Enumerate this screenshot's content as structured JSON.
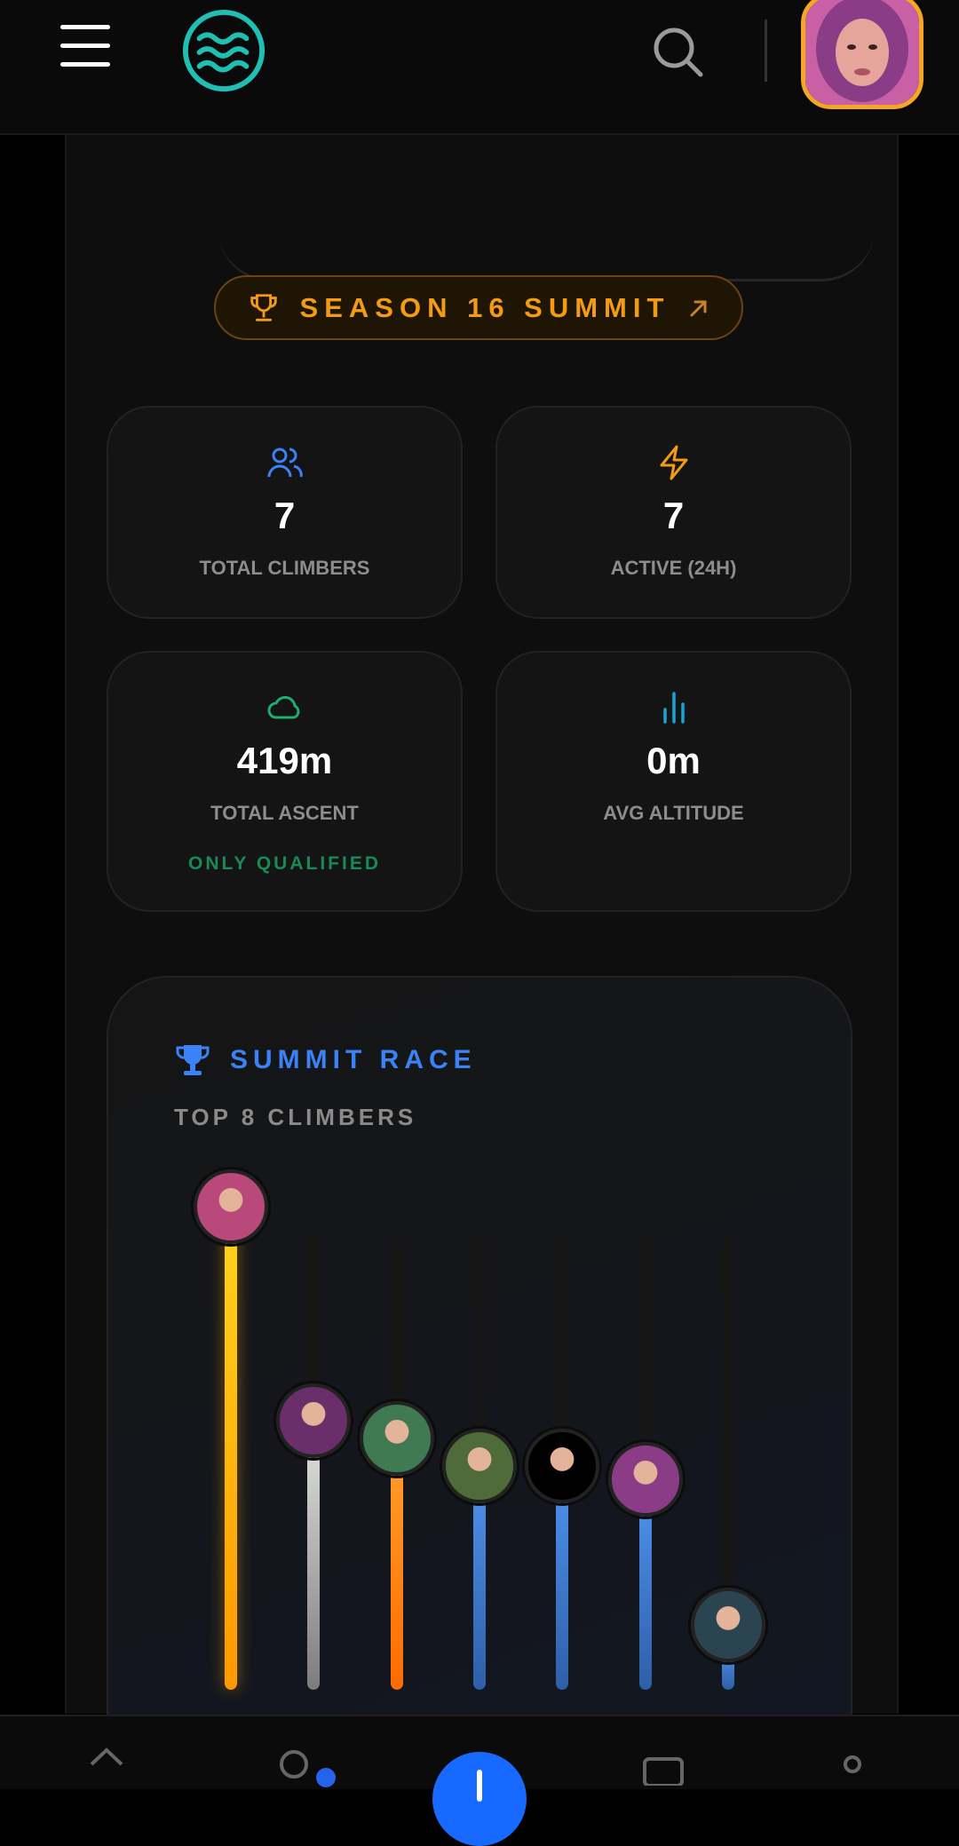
{
  "header": {
    "menu_icon": "hamburger-menu-icon",
    "logo_icon": "waves-logo-icon",
    "search_icon": "search-icon",
    "avatar_accent": "#f5a623"
  },
  "season": {
    "label": "SEASON 16 SUMMIT",
    "icon": "trophy-icon",
    "link_icon": "arrow-up-right-icon",
    "color": "#f39c12"
  },
  "stats": [
    {
      "icon": "users-icon",
      "color": "#3b82f6",
      "value": "7",
      "label": "TOTAL CLIMBERS"
    },
    {
      "icon": "lightning-icon",
      "color": "#f39c12",
      "value": "7",
      "label": "ACTIVE (24H)"
    },
    {
      "icon": "cloud-icon",
      "color": "#1fae72",
      "value": "419m",
      "label": "TOTAL ASCENT",
      "note": "ONLY QUALIFIED"
    },
    {
      "icon": "bar-chart-icon",
      "color": "#16a5d8",
      "value": "0m",
      "label": "AVG ALTITUDE"
    }
  ],
  "race": {
    "title": "SUMMIT RACE",
    "subtitle": "TOP 8 CLIMBERS",
    "climbers": [
      {
        "level": 1.0,
        "color": "gold"
      },
      {
        "level": 0.53,
        "color": "silver"
      },
      {
        "level": 0.49,
        "color": "bronze"
      },
      {
        "level": 0.43,
        "color": "blue"
      },
      {
        "level": 0.43,
        "color": "blue"
      },
      {
        "level": 0.4,
        "color": "blue"
      },
      {
        "level": 0.08,
        "color": "blue"
      }
    ]
  },
  "bottom_nav": {
    "items": [
      "home-icon",
      "people-icon",
      "add-icon",
      "inbox-icon",
      "profile-icon"
    ]
  }
}
